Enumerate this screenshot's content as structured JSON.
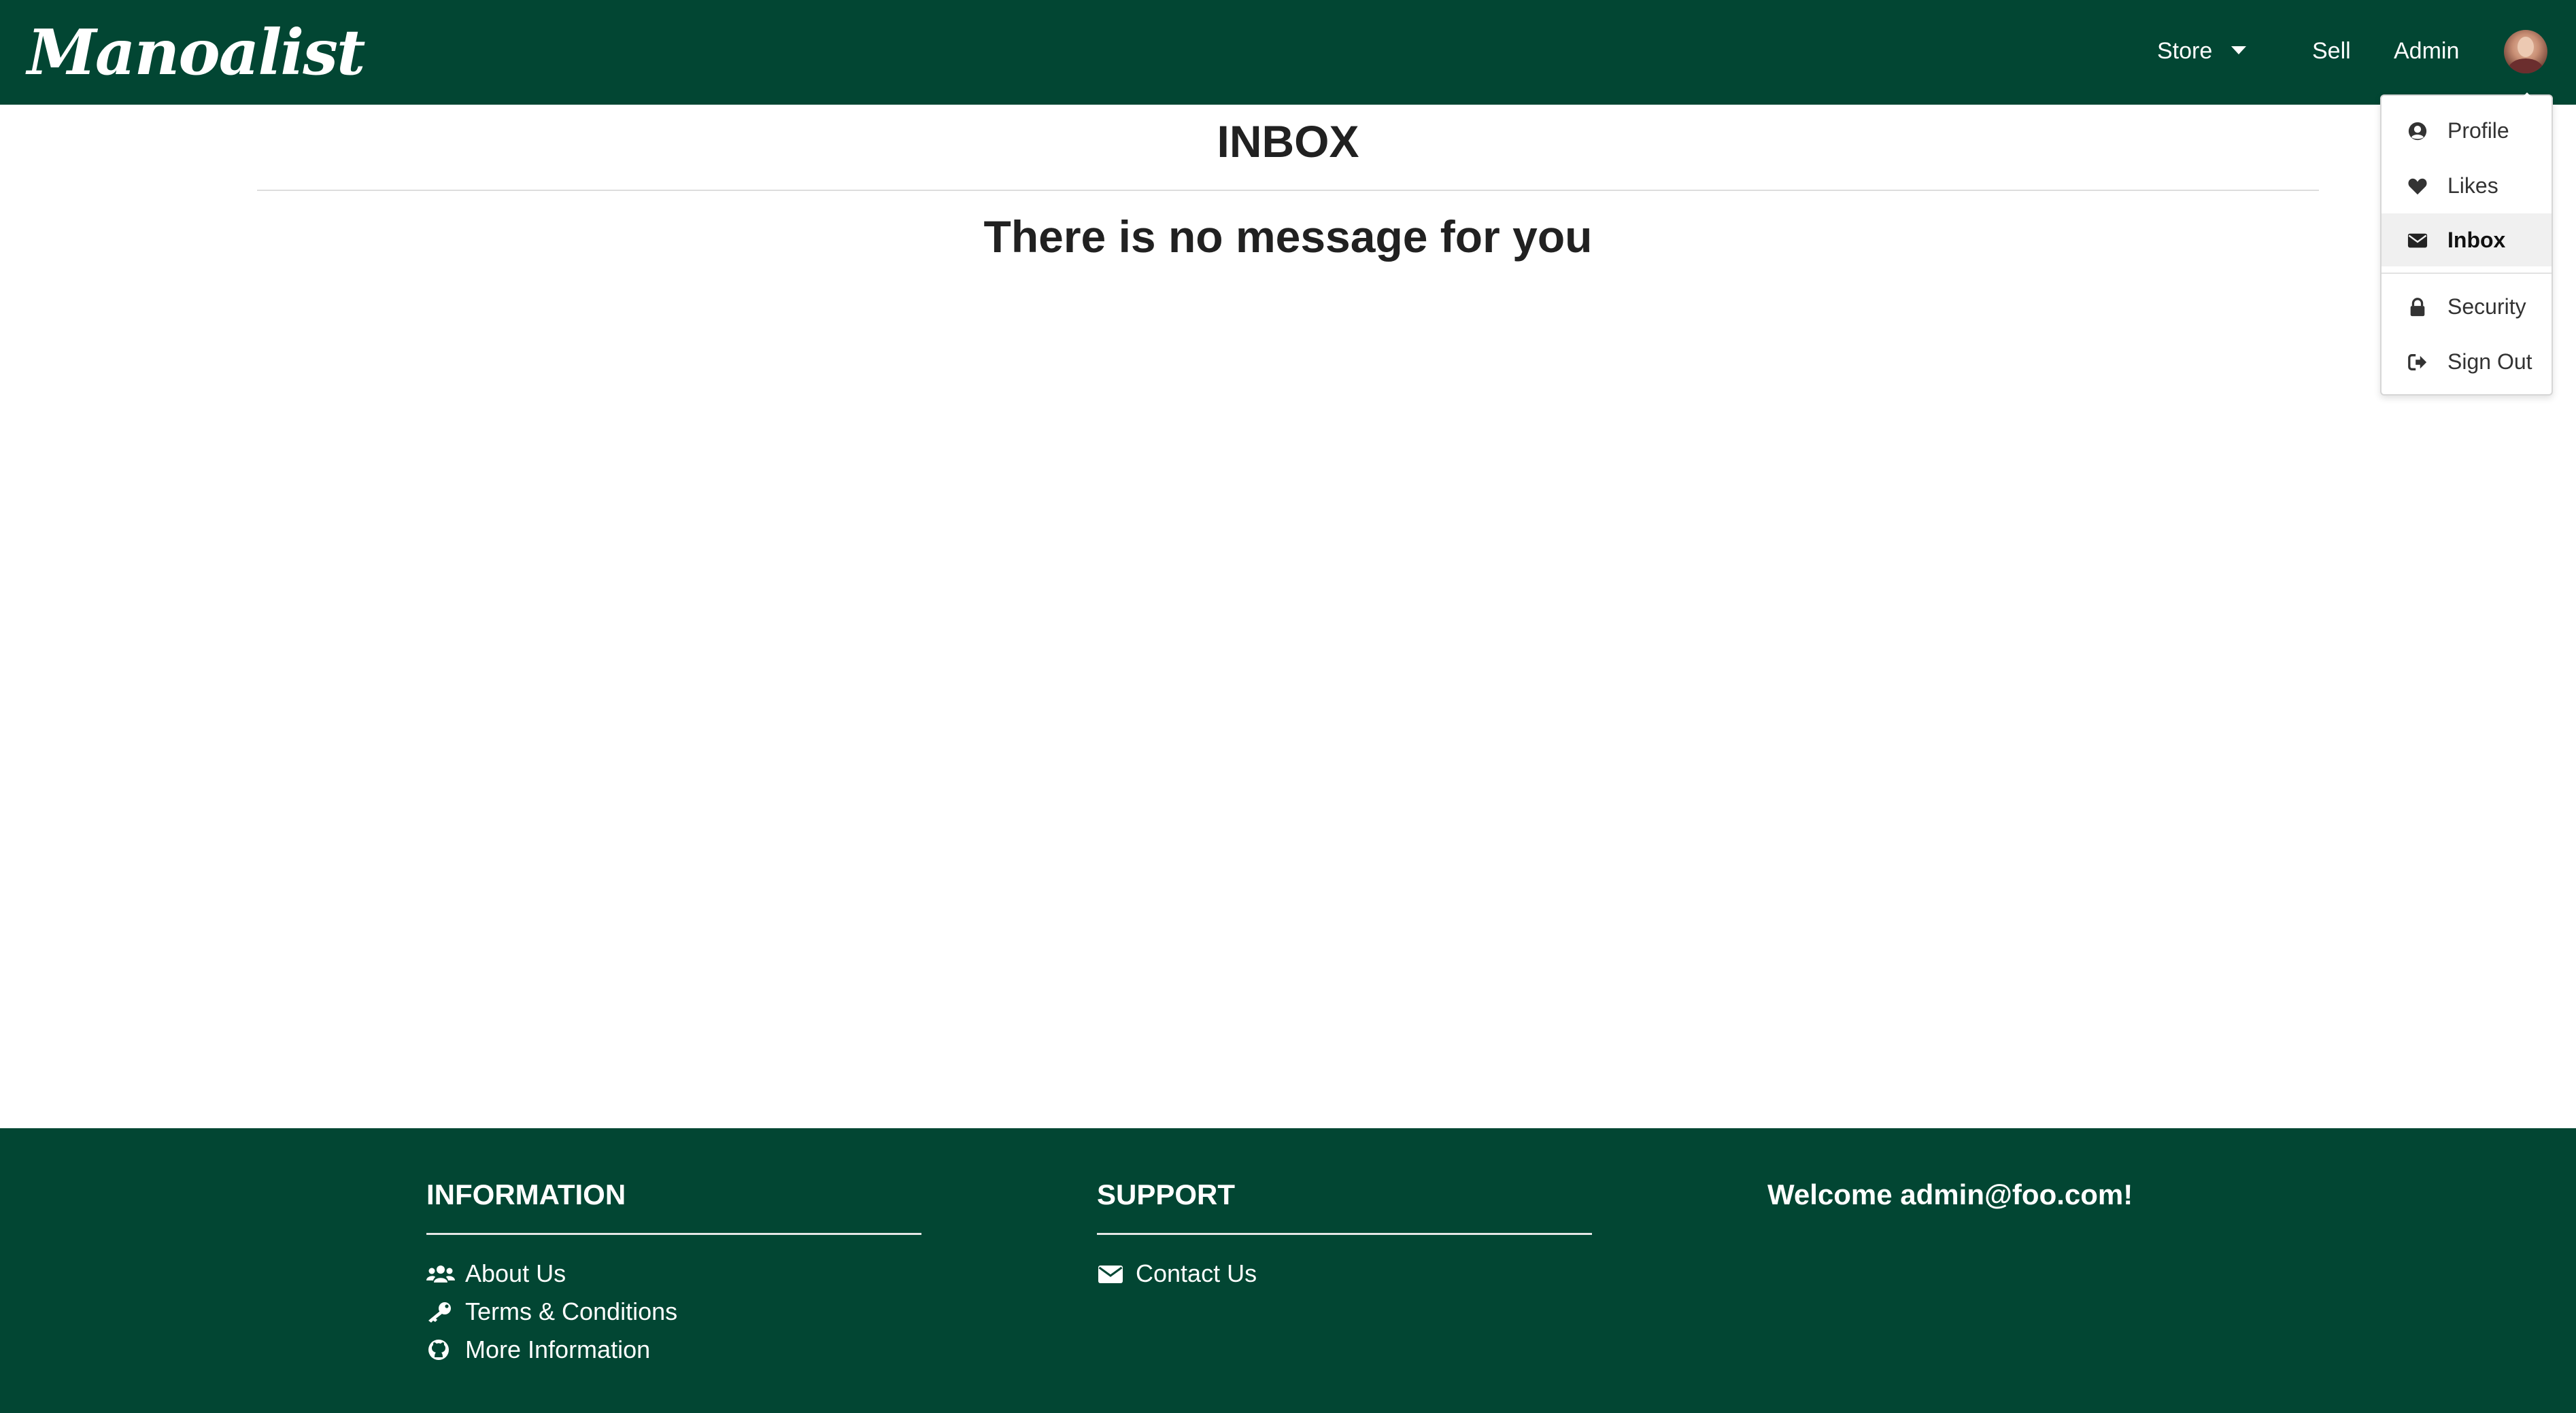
{
  "navbar": {
    "brand": "Manoalist",
    "links": {
      "store": "Store",
      "sell": "Sell",
      "admin": "Admin"
    }
  },
  "dropdown": {
    "items": [
      {
        "label": "Profile",
        "icon": "user-circle-icon"
      },
      {
        "label": "Likes",
        "icon": "heart-icon"
      },
      {
        "label": "Inbox",
        "icon": "envelope-icon",
        "active": true
      },
      {
        "label": "Security",
        "icon": "lock-icon"
      },
      {
        "label": "Sign Out",
        "icon": "sign-out-icon"
      }
    ]
  },
  "main": {
    "title": "INBOX",
    "empty_message": "There is no message for you"
  },
  "footer": {
    "information": {
      "heading": "INFORMATION",
      "links": [
        {
          "label": "About Us",
          "icon": "users-icon"
        },
        {
          "label": "Terms & Conditions",
          "icon": "key-icon"
        },
        {
          "label": "More Information",
          "icon": "github-icon"
        }
      ]
    },
    "support": {
      "heading": "SUPPORT",
      "links": [
        {
          "label": "Contact Us",
          "icon": "envelope-icon"
        }
      ]
    },
    "welcome": "Welcome admin@foo.com!"
  },
  "colors": {
    "primary": "#024633",
    "text": "#212121",
    "active_bg": "#f0f0f0"
  }
}
